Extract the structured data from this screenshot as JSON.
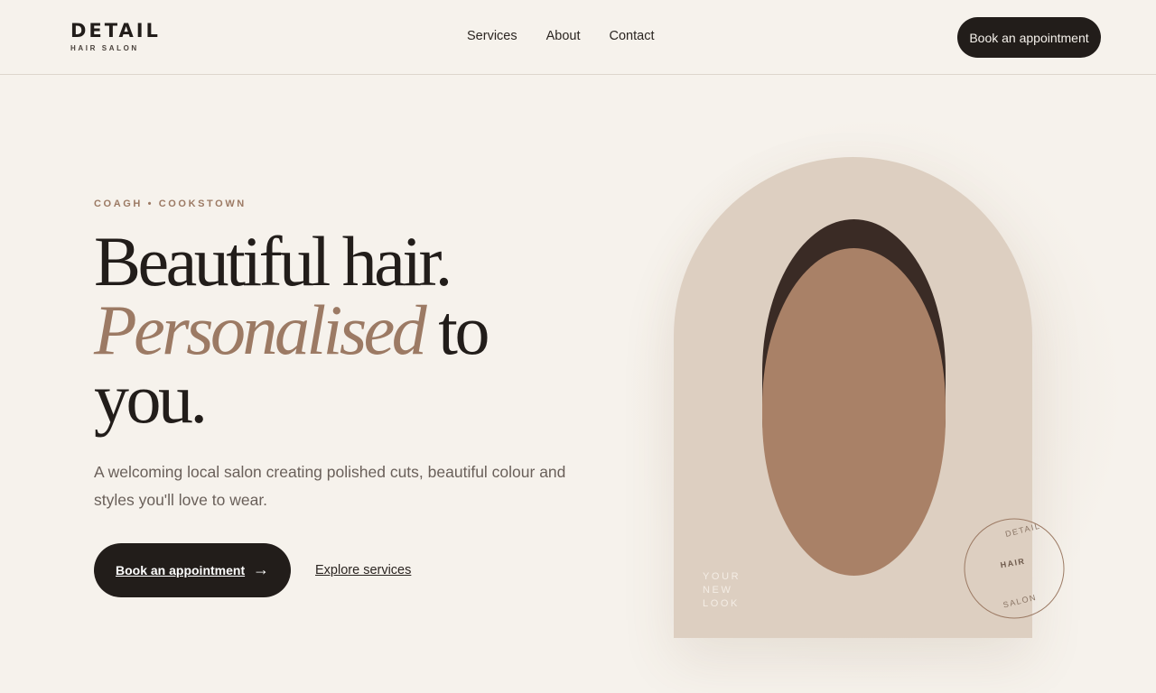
{
  "header": {
    "logo": {
      "name": "DETAIL",
      "tagline": "HAIR SALON"
    },
    "nav": [
      {
        "label": "Services"
      },
      {
        "label": "About"
      },
      {
        "label": "Contact"
      }
    ],
    "cta_label": "Book an appointment"
  },
  "hero": {
    "eyebrow": "COAGH • COOKSTOWN",
    "headline": {
      "line1": "Beautiful hair.",
      "accent": "Personalised",
      "line2_rest": "to",
      "line3": "you."
    },
    "lede": "A welcoming local salon creating polished cuts, beautiful colour and styles you'll love to wear.",
    "primary_cta": {
      "label": "Book an appointment",
      "arrow": "→"
    },
    "secondary_cta": "Explore services"
  },
  "visual": {
    "caption": [
      "YOUR",
      "NEW",
      "LOOK"
    ],
    "stamp": {
      "top": "DETAIL",
      "middle": "HAIR",
      "bottom": "SALON"
    },
    "colors": {
      "background": "#f6f2ec",
      "arch": "#ddcfc1",
      "hair": "#3a2b25",
      "skin": "#a98167",
      "accent": "#9c7a64",
      "ink": "#221d1a"
    }
  }
}
